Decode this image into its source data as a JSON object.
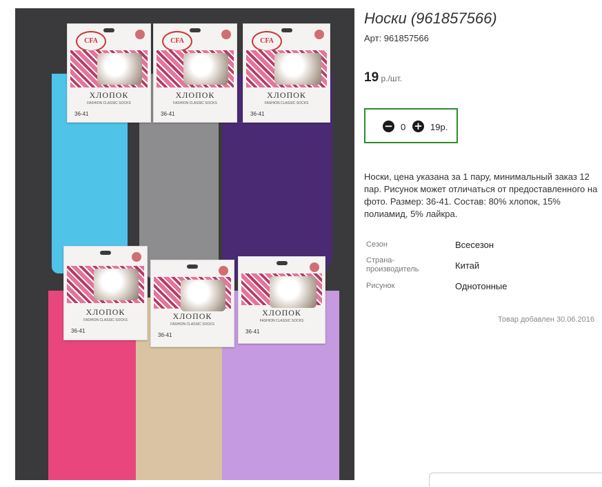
{
  "product": {
    "title": "Носки (961857566)",
    "article": "Арт: 961857566",
    "price_value": "19",
    "price_unit": " р./шт."
  },
  "quantity": {
    "minus_icon": "minus-circle-icon",
    "plus_icon": "plus-circle-icon",
    "value": "0",
    "sum": "19р."
  },
  "description": "Носки, цена указана за 1 пару, минимальный заказ 12 пар. Рисунок может отличаться от предоставленного на фото. Размер: 36-41. Состав: 80% хлопок, 15% полиамид, 5% лайкра.",
  "attributes": [
    {
      "label": "Сезон",
      "value": "Всесезон"
    },
    {
      "label": "Страна-производитель",
      "value": "Китай"
    },
    {
      "label": "Рисунок",
      "value": "Однотонные"
    }
  ],
  "added": "Товар добавлен 30.06.2016",
  "photo": {
    "brand": "CFA",
    "label": "ХЛОПОК",
    "sub_label": "FASHION CLASSIC SOCKS",
    "size": "36-41",
    "sock_colors": [
      "#4fc3e8",
      "#8d8d8f",
      "#4a2a72",
      "#e9467e",
      "#d9c3a2",
      "#c59ae0"
    ]
  },
  "colors": {
    "accent_border": "#2e8b2e"
  }
}
